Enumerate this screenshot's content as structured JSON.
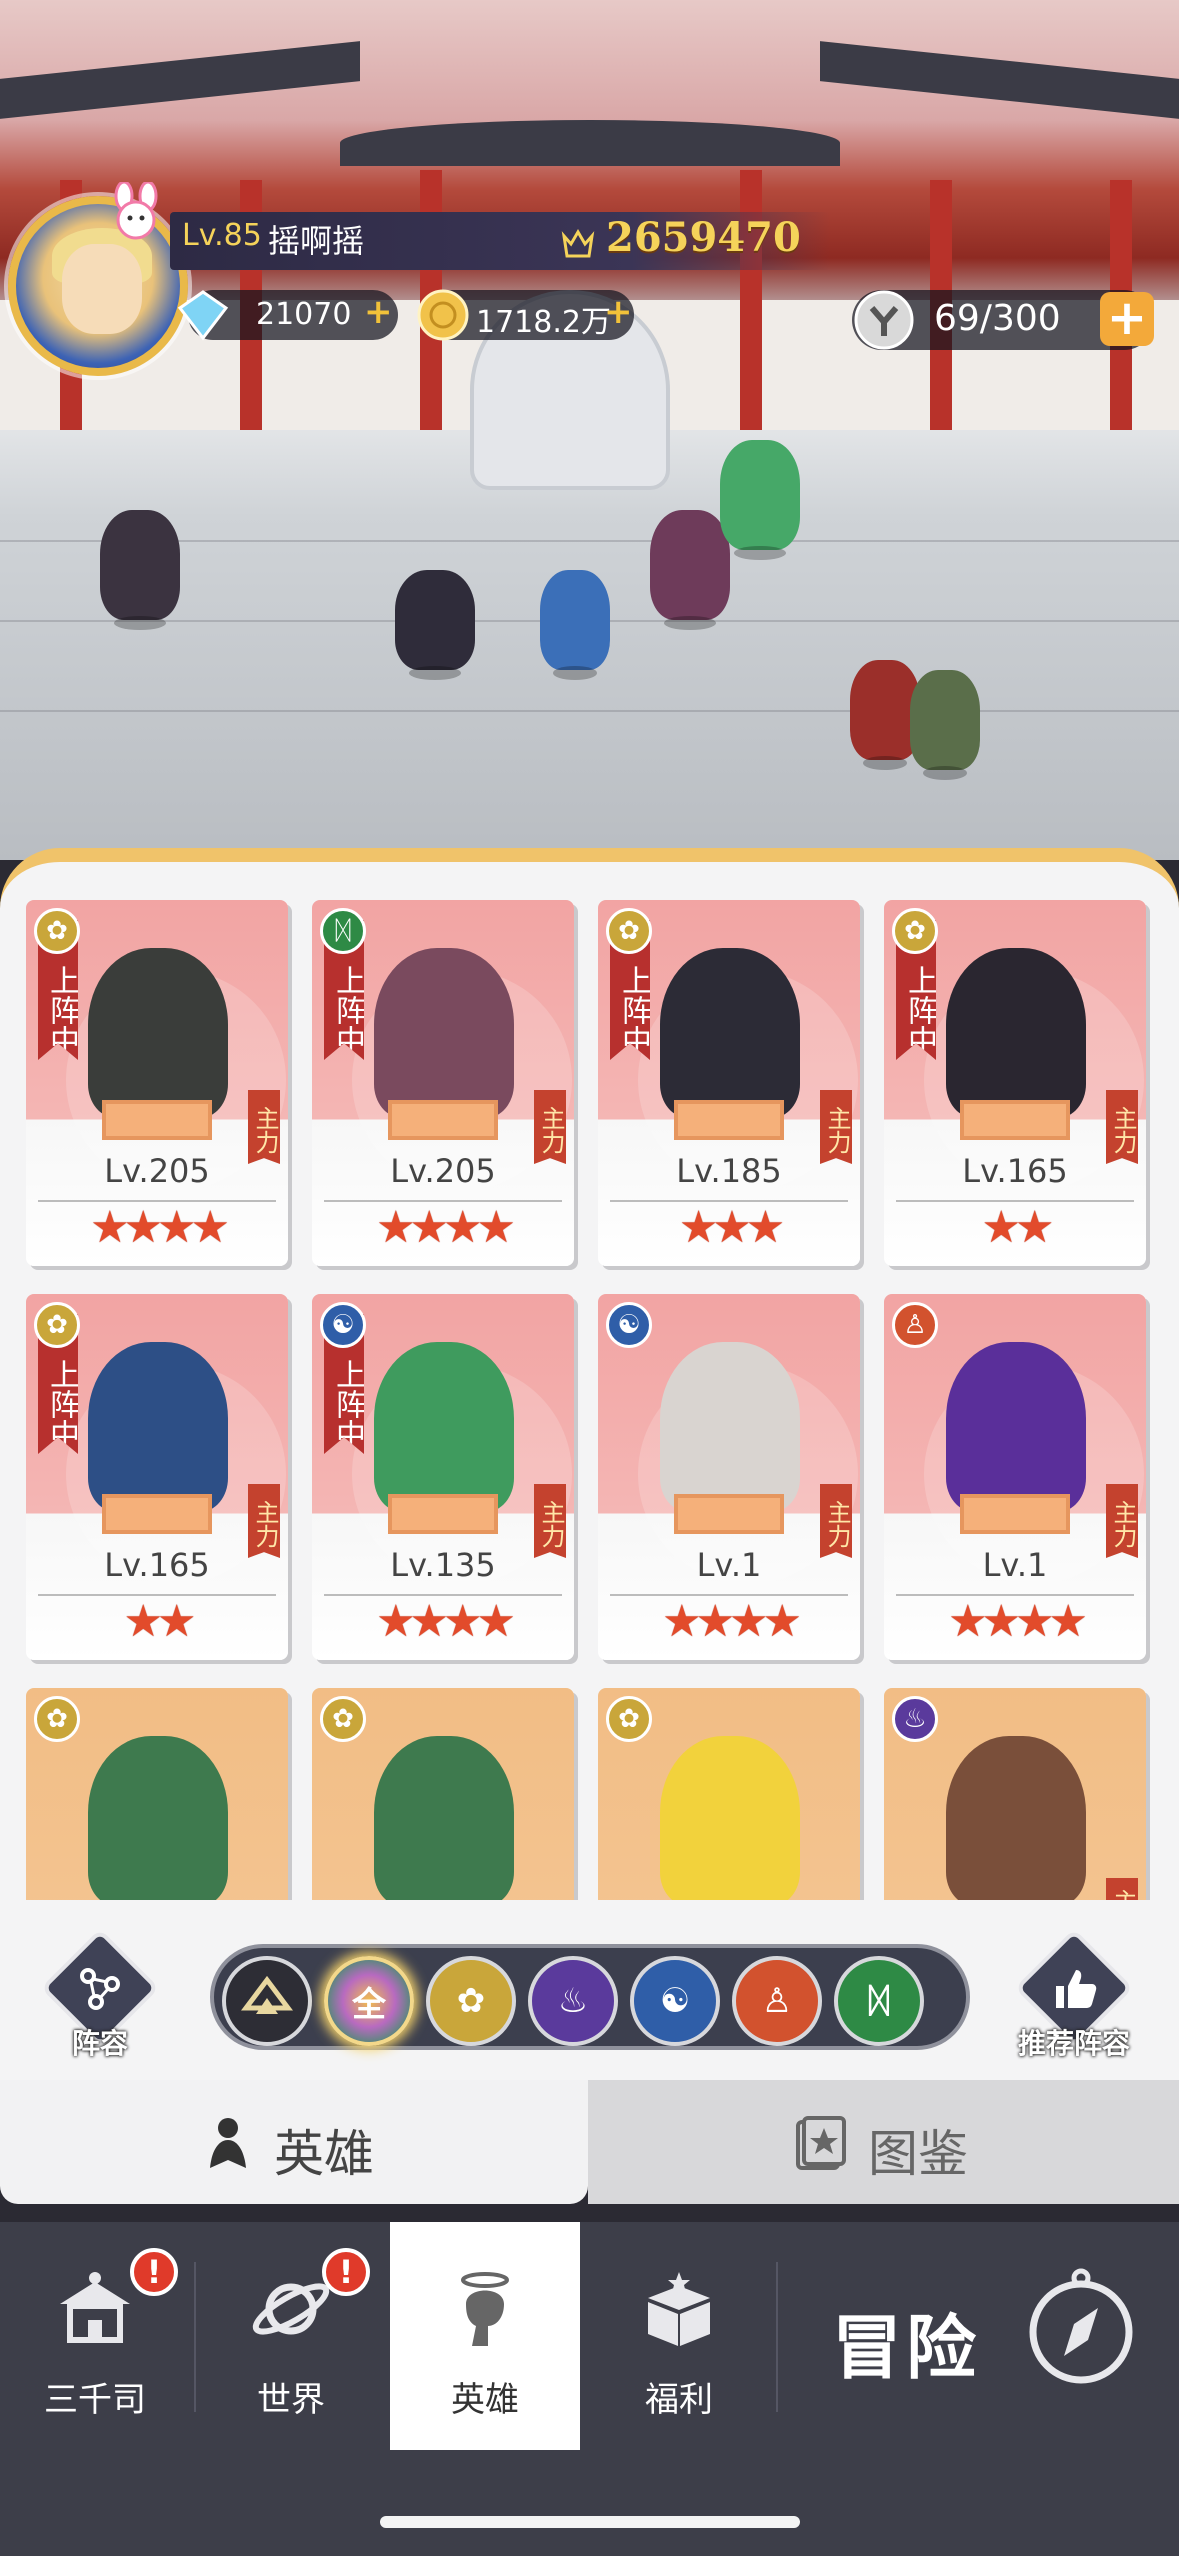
{
  "player": {
    "level_label": "Lv.85",
    "name": "摇啊摇",
    "power": "2659470"
  },
  "currency": {
    "gems": "21070",
    "gold": "1718.2万",
    "stamina": "69/300"
  },
  "heroes": [
    {
      "level": "Lv.205",
      "stars": "★★★★",
      "deployed_label": "上阵中",
      "role_label": "主力",
      "faction": "lotus-icon",
      "bg": "pink"
    },
    {
      "level": "Lv.205",
      "stars": "★★★★",
      "deployed_label": "上阵中",
      "role_label": "主力",
      "faction": "dna-icon",
      "bg": "pink"
    },
    {
      "level": "Lv.185",
      "stars": "★★★",
      "deployed_label": "上阵中",
      "role_label": "主力",
      "faction": "lotus-icon",
      "bg": "pink"
    },
    {
      "level": "Lv.165",
      "stars": "★★",
      "deployed_label": "上阵中",
      "role_label": "主力",
      "faction": "lotus-icon",
      "bg": "pink"
    },
    {
      "level": "Lv.165",
      "stars": "★★",
      "deployed_label": "上阵中",
      "role_label": "主力",
      "faction": "lotus-icon",
      "bg": "pink"
    },
    {
      "level": "Lv.135",
      "stars": "★★★★",
      "deployed_label": "上阵中",
      "role_label": "主力",
      "faction": "taiji-icon",
      "bg": "pink"
    },
    {
      "level": "Lv.1",
      "stars": "★★★★",
      "deployed_label": "",
      "role_label": "主力",
      "faction": "taiji-icon",
      "bg": "pink"
    },
    {
      "level": "Lv.1",
      "stars": "★★★★",
      "deployed_label": "",
      "role_label": "主力",
      "faction": "meditate-icon",
      "bg": "pink"
    },
    {
      "faction": "lotus-icon",
      "bg": "orange"
    },
    {
      "faction": "lotus-icon",
      "bg": "orange"
    },
    {
      "faction": "lotus-icon",
      "bg": "orange"
    },
    {
      "faction": "flame-icon",
      "bg": "orange",
      "role_label": "主"
    }
  ],
  "formation_button": "阵容",
  "recommend_button": "推荐阵容",
  "filters": [
    {
      "icon": "diamond-icon",
      "label": "",
      "color": "#2d2d35"
    },
    {
      "icon": "all-icon",
      "label": "全",
      "color": "#8c6fb8",
      "selected": true
    },
    {
      "icon": "lotus-icon",
      "label": "",
      "color": "#c9a63a"
    },
    {
      "icon": "flame-icon",
      "label": "",
      "color": "#5a3a9c"
    },
    {
      "icon": "taiji-icon",
      "label": "",
      "color": "#2f5ea8"
    },
    {
      "icon": "meditate-icon",
      "label": "",
      "color": "#d2522e"
    },
    {
      "icon": "dna-icon",
      "label": "",
      "color": "#2e8a45"
    }
  ],
  "tabs": {
    "hero": "英雄",
    "codex": "图鉴"
  },
  "nav": {
    "sanqiansi": "三千司",
    "world": "世界",
    "hero": "英雄",
    "welfare": "福利",
    "adventure": "冒险"
  },
  "colors": {
    "accent_gold": "#f5d35a",
    "star_red": "#e24b2b",
    "alert_red": "#e03a2a",
    "plus_orange": "#f3a93a"
  }
}
